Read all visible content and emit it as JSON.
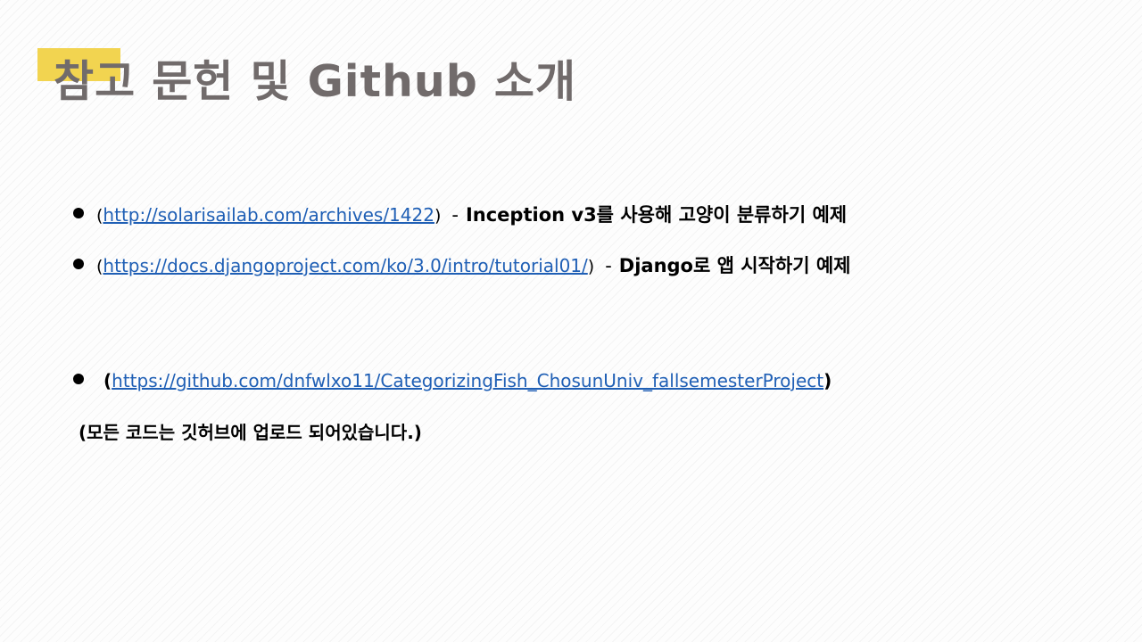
{
  "slide": {
    "title": "참고 문헌 및 Github 소개",
    "accent_color": "#f2d450",
    "references": [
      {
        "open": "(",
        "url": "http://solarisailab.com/archives/1422",
        "close": ")",
        "separator": "-",
        "description": "Inception v3를 사용해 고양이 분류하기 예제"
      },
      {
        "open": "(",
        "url": "https://docs.djangoproject.com/ko/3.0/intro/tutorial01/",
        "close": ")",
        "separator": "-",
        "description": "Django로 앱 시작하기 예제"
      }
    ],
    "github": {
      "open": "(",
      "url": "https://github.com/dnfwlxo11/CategorizingFish_ChosunUniv_fallsemesterProject",
      "close": ")"
    },
    "note": "(모든 코드는 깃허브에 업로드 되어있습니다.)"
  }
}
